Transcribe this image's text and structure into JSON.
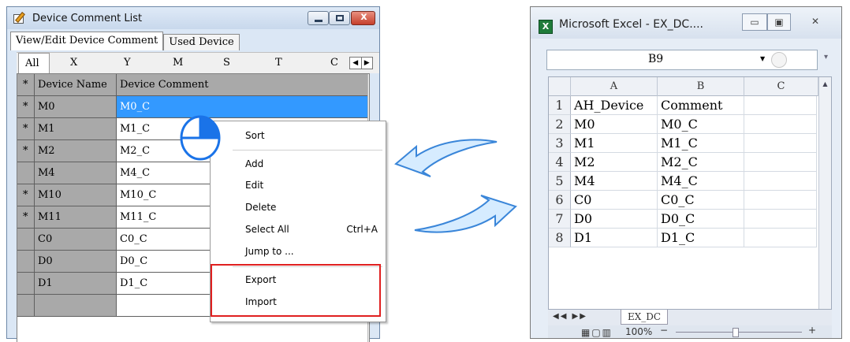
{
  "device_window": {
    "title": "Device Comment List",
    "controls": {
      "close_glyph": "x"
    },
    "tabs": [
      {
        "label": "View/Edit Device Comment",
        "active": true
      },
      {
        "label": "Used Device",
        "active": false
      }
    ],
    "letter_tabs": [
      "All",
      "X",
      "Y",
      "M",
      "S",
      "T",
      "C"
    ],
    "arrow_left": "◀",
    "arrow_right": "▶",
    "headers": {
      "marker": "*",
      "name": "Device Name",
      "comment": "Device Comment"
    },
    "rows": [
      {
        "marker": "*",
        "name": "M0",
        "comment": "M0_C",
        "selected": true
      },
      {
        "marker": "*",
        "name": "M1",
        "comment": "M1_C"
      },
      {
        "marker": "*",
        "name": "M2",
        "comment": "M2_C"
      },
      {
        "marker": "",
        "name": "M4",
        "comment": "M4_C"
      },
      {
        "marker": "*",
        "name": "M10",
        "comment": "M10_C"
      },
      {
        "marker": "*",
        "name": "M11",
        "comment": "M11_C"
      },
      {
        "marker": "",
        "name": "C0",
        "comment": "C0_C"
      },
      {
        "marker": "",
        "name": "D0",
        "comment": "D0_C"
      },
      {
        "marker": "",
        "name": "D1",
        "comment": "D1_C"
      }
    ]
  },
  "context_menu": {
    "sort": "Sort",
    "add": "Add",
    "edit": "Edit",
    "delete": "Delete",
    "select_all": "Select All",
    "select_all_shortcut": "Ctrl+A",
    "jump_to": "Jump to ...",
    "export": "Export",
    "import": "Import",
    "highlight_color": "#e02020"
  },
  "excel_window": {
    "title": "Microsoft Excel - EX_DC....",
    "name_box": "B9",
    "columns": [
      "A",
      "B",
      "C"
    ],
    "rows": [
      {
        "n": "1",
        "a": "AH_Device",
        "b": "Comment"
      },
      {
        "n": "2",
        "a": "M0",
        "b": "M0_C"
      },
      {
        "n": "3",
        "a": "M1",
        "b": "M1_C"
      },
      {
        "n": "4",
        "a": "M2",
        "b": "M2_C"
      },
      {
        "n": "5",
        "a": "M4",
        "b": "M4_C"
      },
      {
        "n": "6",
        "a": "C0",
        "b": "C0_C"
      },
      {
        "n": "7",
        "a": "D0",
        "b": "D0_C"
      },
      {
        "n": "8",
        "a": "D1",
        "b": "D1_C"
      }
    ],
    "sheet_tab": "EX_DC",
    "zoom": "100%",
    "zoom_minus": "−",
    "zoom_plus": "+"
  },
  "colors": {
    "selection": "#3399ff",
    "arrow_fill": "#d6ecff",
    "arrow_stroke": "#3a86d9",
    "pie": "#1a73e8"
  }
}
